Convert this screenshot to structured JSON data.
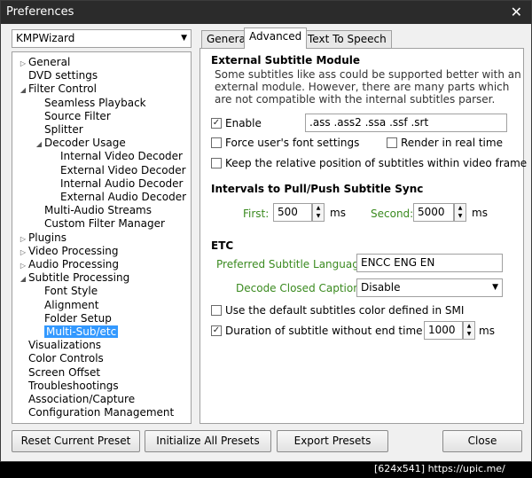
{
  "window": {
    "title": "Preferences",
    "close_glyph": "✕"
  },
  "preset": {
    "value": "KMPWizard",
    "arrow": "▼"
  },
  "tree": [
    {
      "label": "General",
      "toggle": "▷",
      "level": 0
    },
    {
      "label": "DVD settings",
      "toggle": "",
      "level": 0
    },
    {
      "label": "Filter Control",
      "toggle": "◢",
      "level": 0
    },
    {
      "label": "Seamless Playback",
      "toggle": "",
      "level": 1
    },
    {
      "label": "Source Filter",
      "toggle": "",
      "level": 1
    },
    {
      "label": "Splitter",
      "toggle": "",
      "level": 1
    },
    {
      "label": "Decoder Usage",
      "toggle": "◢",
      "level": 1
    },
    {
      "label": "Internal Video Decoder",
      "toggle": "",
      "level": 2
    },
    {
      "label": "External Video Decoder",
      "toggle": "",
      "level": 2
    },
    {
      "label": "Internal Audio Decoder",
      "toggle": "",
      "level": 2
    },
    {
      "label": "External Audio Decoder",
      "toggle": "",
      "level": 2
    },
    {
      "label": "Multi-Audio Streams",
      "toggle": "",
      "level": 1
    },
    {
      "label": "Custom Filter Manager",
      "toggle": "",
      "level": 1
    },
    {
      "label": "Plugins",
      "toggle": "▷",
      "level": 0
    },
    {
      "label": "Video Processing",
      "toggle": "▷",
      "level": 0
    },
    {
      "label": "Audio Processing",
      "toggle": "▷",
      "level": 0
    },
    {
      "label": "Subtitle Processing",
      "toggle": "◢",
      "level": 0
    },
    {
      "label": "Font Style",
      "toggle": "",
      "level": 1
    },
    {
      "label": "Alignment",
      "toggle": "",
      "level": 1
    },
    {
      "label": "Folder Setup",
      "toggle": "",
      "level": 1
    },
    {
      "label": "Multi-Sub/etc",
      "toggle": "",
      "level": 1,
      "selected": true
    },
    {
      "label": "Visualizations",
      "toggle": "",
      "level": 0
    },
    {
      "label": "Color Controls",
      "toggle": "",
      "level": 0
    },
    {
      "label": "Screen Offset",
      "toggle": "",
      "level": 0
    },
    {
      "label": "Troubleshootings",
      "toggle": "",
      "level": 0
    },
    {
      "label": "Association/Capture",
      "toggle": "",
      "level": 0
    },
    {
      "label": "Configuration Management",
      "toggle": "",
      "level": 0
    }
  ],
  "tabs": {
    "general": "General",
    "advanced": "Advanced",
    "tts": "Text To Speech"
  },
  "external": {
    "title": "External Subtitle Module",
    "desc": "Some subtitles like ass could be supported better with an external module. However, there are many parts which are not compatible with the internal subtitles parser.",
    "enable_label": "Enable",
    "enable_checked": "✓",
    "extensions": ".ass .ass2 .ssa .ssf .srt",
    "force_font_label": "Force user's font settings",
    "render_realtime_label": "Render in real time",
    "keep_position_label": "Keep the relative position of subtitles within video frame"
  },
  "intervals": {
    "title": "Intervals to Pull/Push Subtitle Sync",
    "first_label": "First:",
    "first_value": "500",
    "first_unit": "ms",
    "second_label": "Second:",
    "second_value": "5000",
    "second_unit": "ms"
  },
  "etc": {
    "title": "ETC",
    "language_label": "Preferred Subtitle Language:",
    "language_value": "ENCC ENG EN",
    "captions_label": "Decode Closed Captions:",
    "captions_value": "Disable",
    "captions_arrow": "▼",
    "default_color_label": "Use the default subtitles color defined in SMI",
    "duration_label": "Duration of subtitle without end time",
    "duration_checked": "✓",
    "duration_value": "1000",
    "duration_unit": "ms"
  },
  "spin": {
    "up": "▲",
    "down": "▼"
  },
  "buttons": {
    "reset": "Reset Current Preset",
    "initialize": "Initialize All Presets",
    "export": "Export Presets",
    "close": "Close"
  },
  "footer": "[624x541] https://upic.me/"
}
